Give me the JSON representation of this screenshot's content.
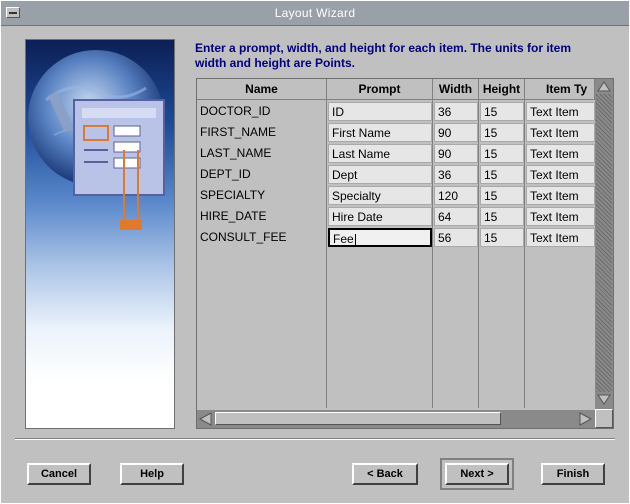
{
  "window": {
    "title": "Layout Wizard"
  },
  "instructions": "Enter a prompt, width, and height for each item. The units for item width and height are Points.",
  "grid": {
    "columns": [
      "Name",
      "Prompt",
      "Width",
      "Height",
      "Item Ty"
    ],
    "rows": [
      {
        "name": "DOCTOR_ID",
        "prompt": "ID",
        "width": "36",
        "height": "15",
        "item_type": "Text Item"
      },
      {
        "name": "FIRST_NAME",
        "prompt": "First Name",
        "width": "90",
        "height": "15",
        "item_type": "Text Item"
      },
      {
        "name": "LAST_NAME",
        "prompt": "Last Name",
        "width": "90",
        "height": "15",
        "item_type": "Text Item"
      },
      {
        "name": "DEPT_ID",
        "prompt": "Dept",
        "width": "36",
        "height": "15",
        "item_type": "Text Item"
      },
      {
        "name": "SPECIALTY",
        "prompt": "Specialty",
        "width": "120",
        "height": "15",
        "item_type": "Text Item"
      },
      {
        "name": "HIRE_DATE",
        "prompt": "Hire Date",
        "width": "64",
        "height": "15",
        "item_type": "Text Item"
      },
      {
        "name": "CONSULT_FEE",
        "prompt": "Fee",
        "width": "56",
        "height": "15",
        "item_type": "Text Item"
      }
    ]
  },
  "buttons": {
    "cancel": "Cancel",
    "help": "Help",
    "back": "< Back",
    "next": "Next >",
    "finish": "Finish"
  },
  "icons": [
    "system-menu-icon",
    "scroll-up-icon",
    "scroll-down-icon",
    "scroll-left-icon",
    "scroll-right-icon",
    "wizard-illustration"
  ],
  "colors": {
    "instruction_text": "#000080",
    "background": "#c0c0c0",
    "titlebar": "#9aa0a7"
  }
}
